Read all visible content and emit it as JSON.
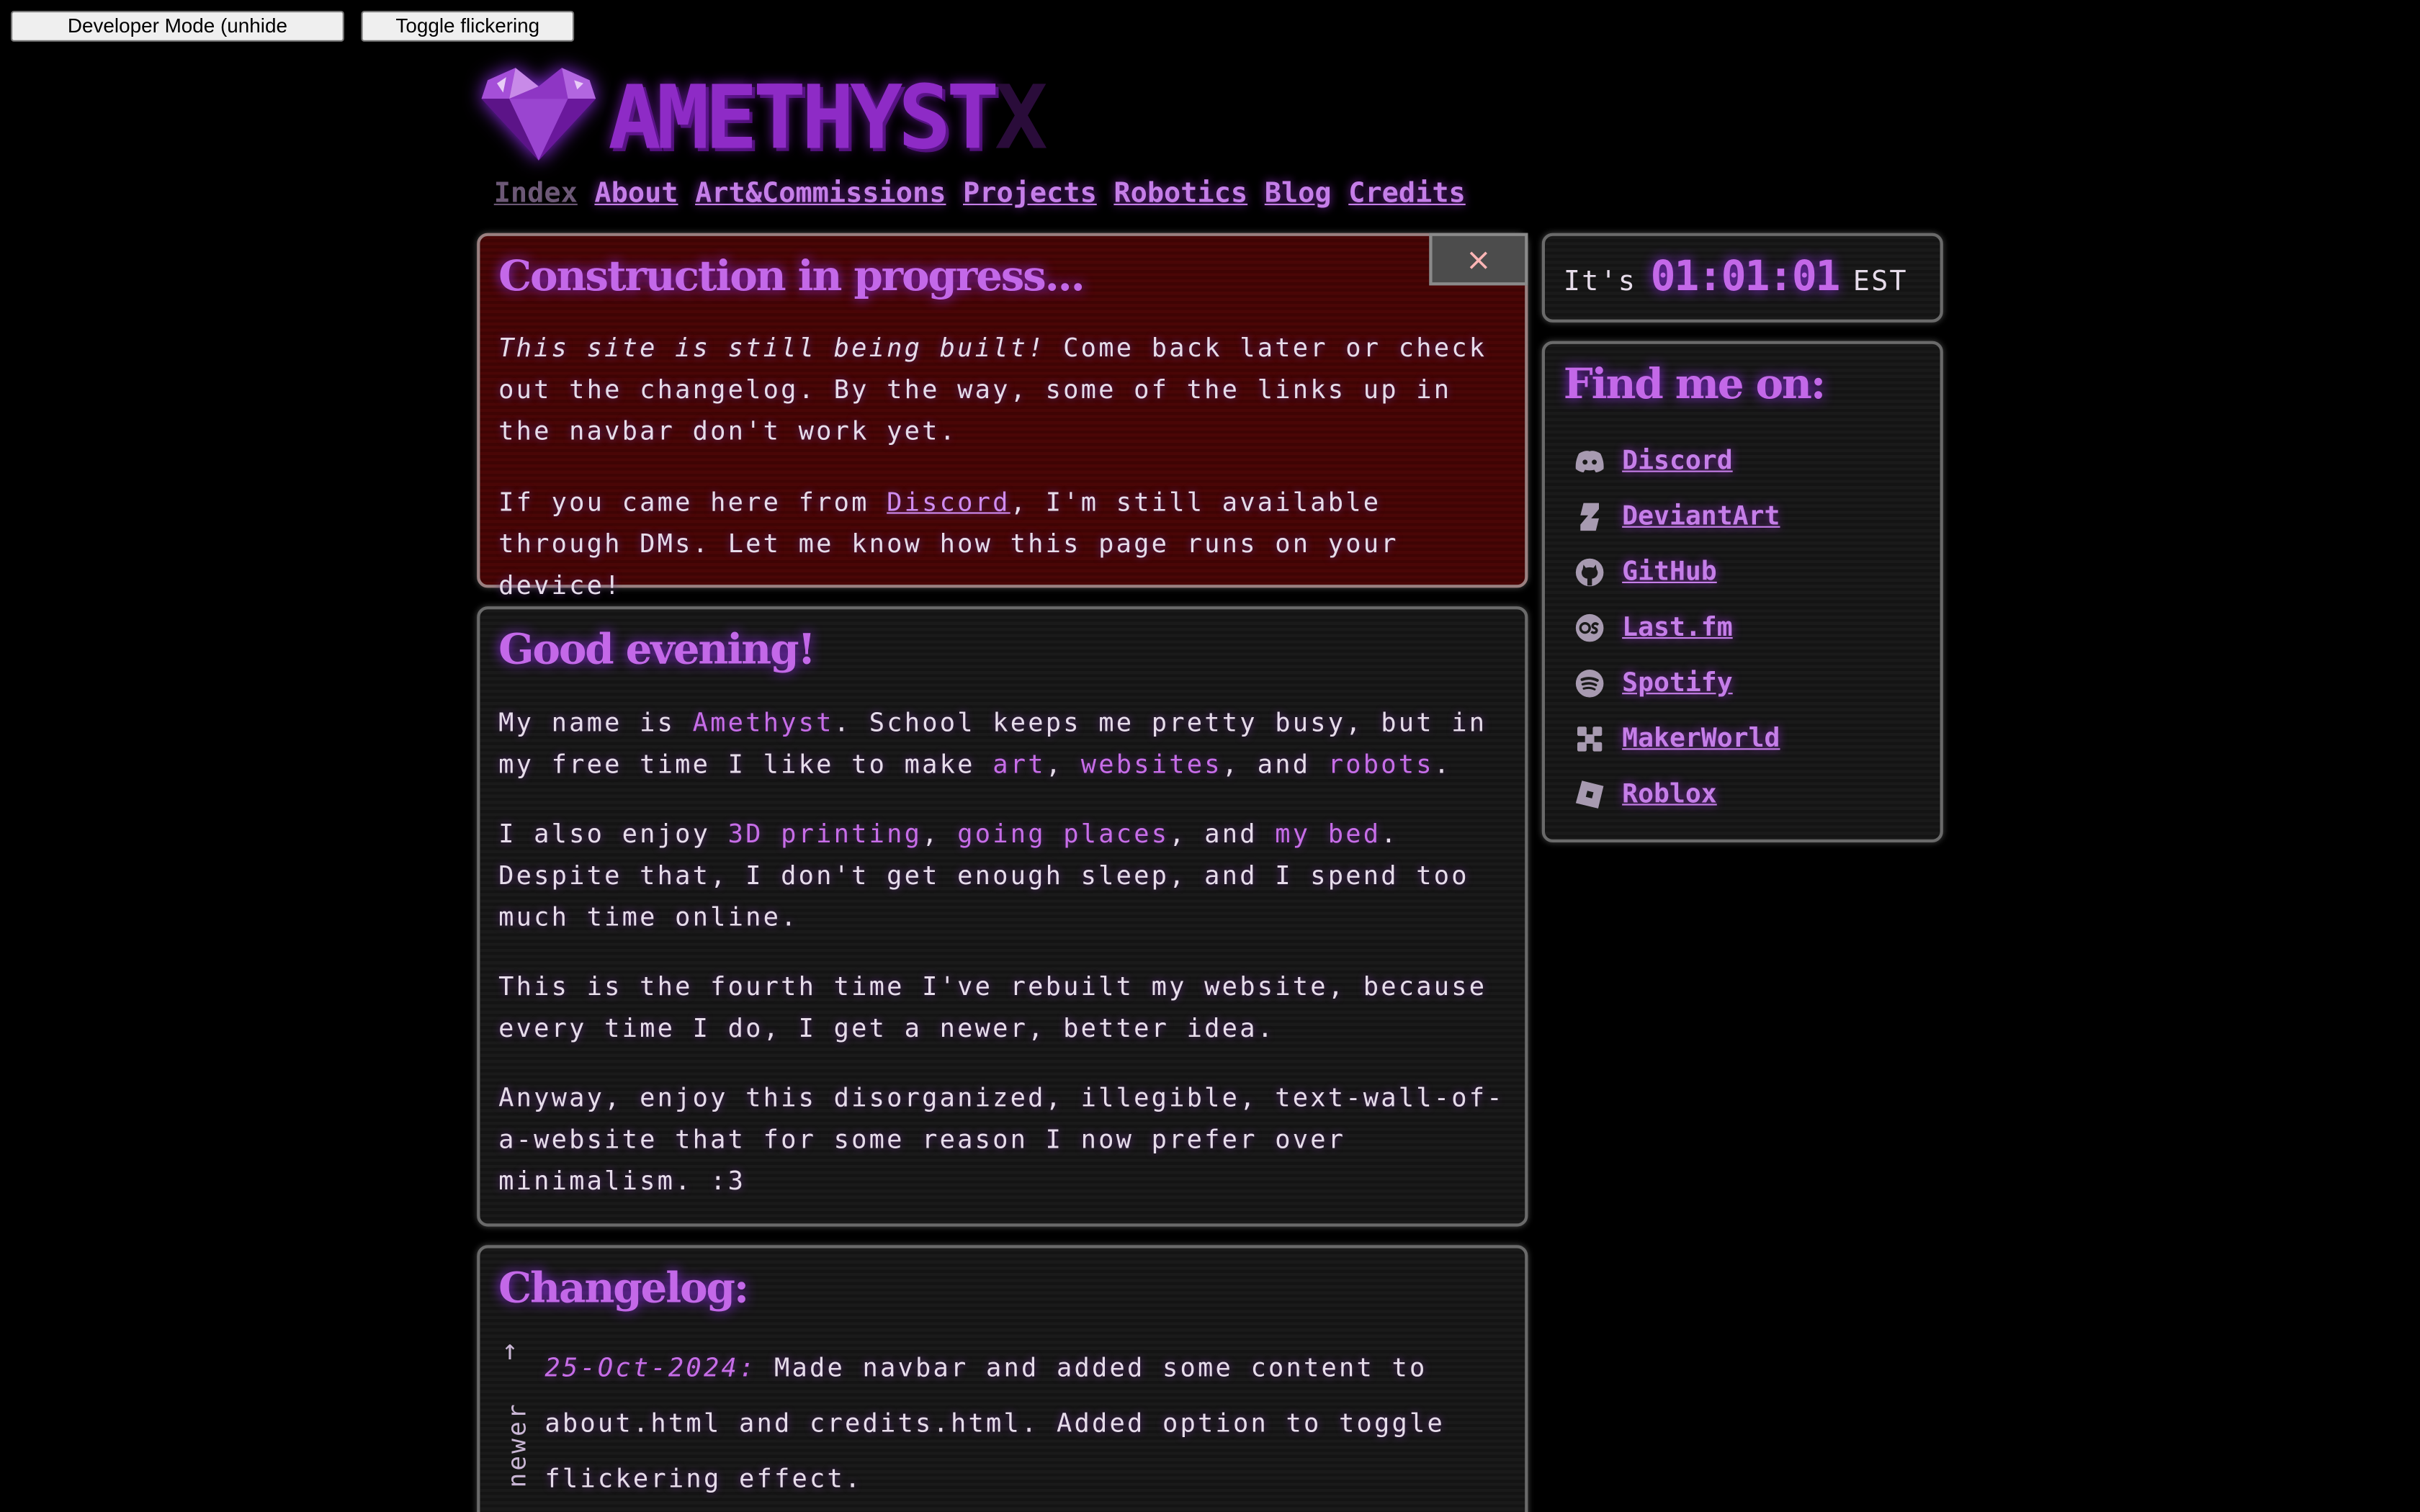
{
  "top_buttons": {
    "dev_mode": "Developer Mode (unhide everything)",
    "flicker": "Toggle flickering effect"
  },
  "logo": {
    "text_main": "AMETHYST",
    "text_dim": "X"
  },
  "nav": {
    "items": [
      {
        "label": "Index",
        "current": true
      },
      {
        "label": "About"
      },
      {
        "label": "Art&Commissions"
      },
      {
        "label": "Projects"
      },
      {
        "label": "Robotics"
      },
      {
        "label": "Blog"
      },
      {
        "label": "Credits"
      }
    ]
  },
  "construction": {
    "title": "Construction in progress...",
    "close_label": "×",
    "p1_italic": "This site is still being built!",
    "p1_rest": " Come back later or check out the changelog. By the way, some of the links up in the navbar don't work yet.",
    "p2_before": "If you came here from ",
    "p2_link": "Discord",
    "p2_after": ", I'm still available through DMs. Let me know how this page runs on your device!"
  },
  "greeting": {
    "title": "Good evening!",
    "p1": {
      "a": "My name is ",
      "name": "Amethyst",
      "b": ". School keeps me pretty busy, but in my free time I like to make ",
      "art": "art",
      "c": ", ",
      "websites": "websites",
      "d": ", and ",
      "robots": "robots",
      "e": "."
    },
    "p2": {
      "a": "I also enjoy ",
      "printing": "3D printing",
      "b": ", ",
      "places": "going places",
      "c": ", and ",
      "bed": "my bed",
      "d": ". Despite that, I don't get enough sleep, and I spend too much time online."
    },
    "p3": "This is the fourth time I've rebuilt my website, because every time I do, I get a newer, better idea.",
    "p4": "Anyway, enjoy this disorganized, illegible, text-wall-of-a-website that for some reason I now prefer over minimalism. :3"
  },
  "changelog": {
    "title": "Changelog:",
    "newer_arrow": "↑",
    "newer_label": "newer",
    "entry_date": "25-Oct-2024:",
    "entry_text": " Made navbar and added some content to about.html and credits.html. Added option to toggle flickering effect."
  },
  "clock": {
    "prefix": "It's",
    "time": "01:01:01",
    "zone": "EST"
  },
  "social": {
    "title": "Find me on:",
    "items": [
      {
        "label": "Discord",
        "icon": "discord-icon"
      },
      {
        "label": "DeviantArt",
        "icon": "deviantart-icon"
      },
      {
        "label": "GitHub",
        "icon": "github-icon"
      },
      {
        "label": "Last.fm",
        "icon": "lastfm-icon"
      },
      {
        "label": "Spotify",
        "icon": "spotify-icon"
      },
      {
        "label": "MakerWorld",
        "icon": "makerworld-icon"
      },
      {
        "label": "Roblox",
        "icon": "roblox-icon"
      }
    ]
  },
  "colors": {
    "accent": "#c368e8",
    "link": "#c57ee8",
    "warning_panel": "#4a0606",
    "panel": "#1a1a1a"
  }
}
